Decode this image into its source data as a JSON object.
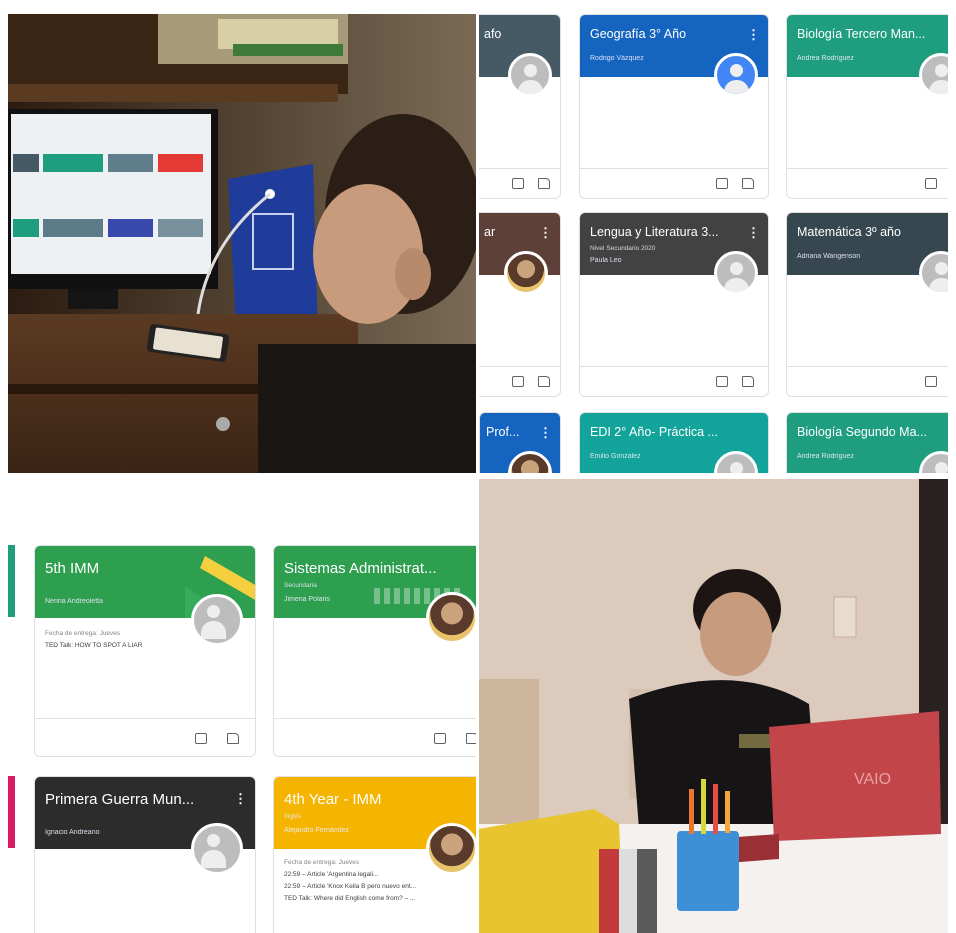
{
  "top_right": {
    "cards": [
      {
        "title": "afo",
        "color": "#455a64"
      },
      {
        "title": "Geografía 3° Año",
        "sub": "Rodrigo Vázquez",
        "color": "#1565c0"
      },
      {
        "title": "Biología Tercero Man...",
        "sub": "Andrea Rodríguez",
        "color": "#1e9e7e"
      },
      {
        "title": "ar",
        "sub": "...",
        "color": "#5d4037"
      },
      {
        "title": "Lengua y Literatura 3...",
        "sub": "Nivel Secundario 2020",
        "sub2": "Paula Leo",
        "color": "#424242"
      },
      {
        "title": "Matemática 3º año",
        "sub": "Adriana Wangenson",
        "color": "#37474f"
      },
      {
        "title": "Prof...",
        "color": "#1565c0"
      },
      {
        "title": "EDI 2° Año- Práctica ...",
        "sub": "Emilio González",
        "color": "#12a39a"
      },
      {
        "title": "Biología Segundo Ma...",
        "sub": "Andrea Rodríguez",
        "color": "#1e9e7e"
      }
    ]
  },
  "bottom_left": {
    "cards": [
      {
        "title": "5th IMM",
        "sub": "Nerina Andreoletta",
        "color": "#2e9e4f",
        "due_label": "Fecha de entrega: Jueves",
        "due_items": [
          "TED Talk: HOW TO SPOT A LIAR"
        ]
      },
      {
        "title": "Sistemas Administrat...",
        "sub2": "Secundaria",
        "sub": "Jimena Polaris",
        "color": "#2e9e4f"
      },
      {
        "title": "Primera Guerra Mun...",
        "sub": "Ignacio Andreano",
        "color": "#2c2c2c"
      },
      {
        "title": "4th Year - IMM",
        "sub2": "Inglés",
        "sub": "Alejandro Fernández",
        "color": "#f4b400",
        "due_label": "Fecha de entrega: Jueves",
        "due_items": [
          "22:59 – Article 'Argentina legali...",
          "22:59 – Article 'Knox Keila B pero nuevo ent...",
          "TED Talk: Where did English come from? – ..."
        ]
      }
    ]
  },
  "photos": {
    "top_left": "boy-at-desktop-monitor-photo",
    "bottom_right": "boy-with-red-laptop-photo",
    "laptop_brand": "VAIO"
  }
}
